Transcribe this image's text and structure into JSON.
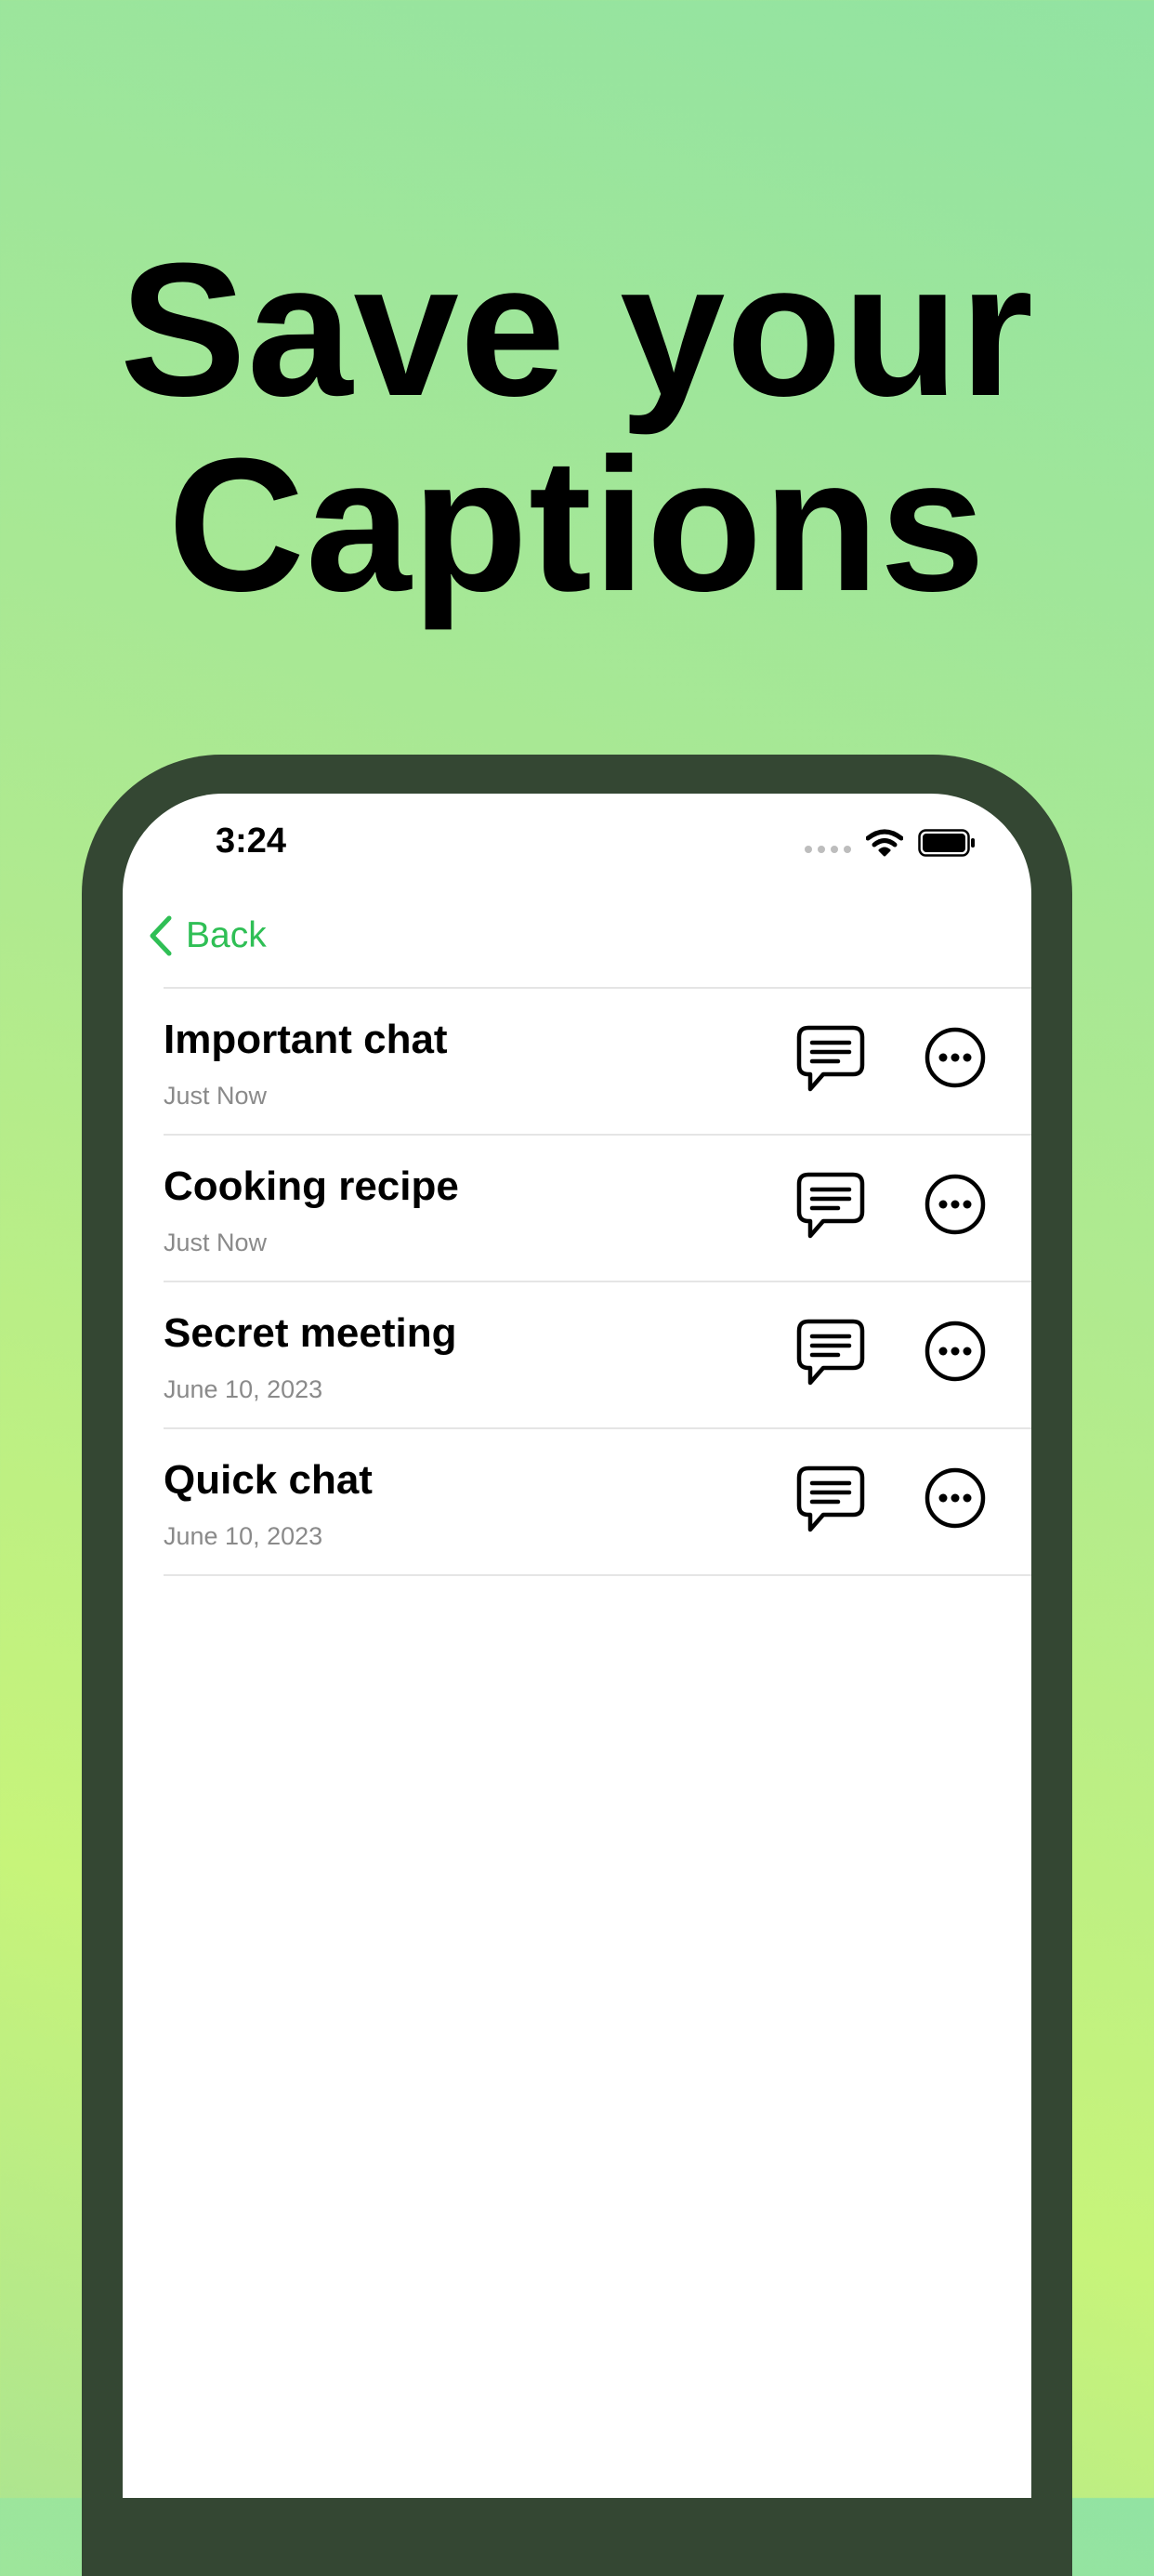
{
  "headline": {
    "line1": "Save your",
    "line2": "Captions"
  },
  "status_bar": {
    "time": "3:24",
    "icons": [
      "signal-icon",
      "wifi-icon",
      "battery-icon"
    ]
  },
  "nav": {
    "back_label": "Back",
    "back_icon": "chevron-left-icon"
  },
  "captions": [
    {
      "title": "Important chat",
      "date": "Just Now"
    },
    {
      "title": "Cooking recipe",
      "date": "Just Now"
    },
    {
      "title": "Secret meeting",
      "date": "June 10, 2023"
    },
    {
      "title": "Quick chat",
      "date": "June 10, 2023"
    }
  ],
  "row_icons": {
    "open": "chat-bubble-icon",
    "more": "ellipsis-circle-icon"
  },
  "colors": {
    "accent": "#2fbf55",
    "phone_frame": "#344733",
    "text": "#000000",
    "secondary_text": "#8a8a8a",
    "background_top": "#92e3a2",
    "background_bottom": "#c7f47a"
  }
}
